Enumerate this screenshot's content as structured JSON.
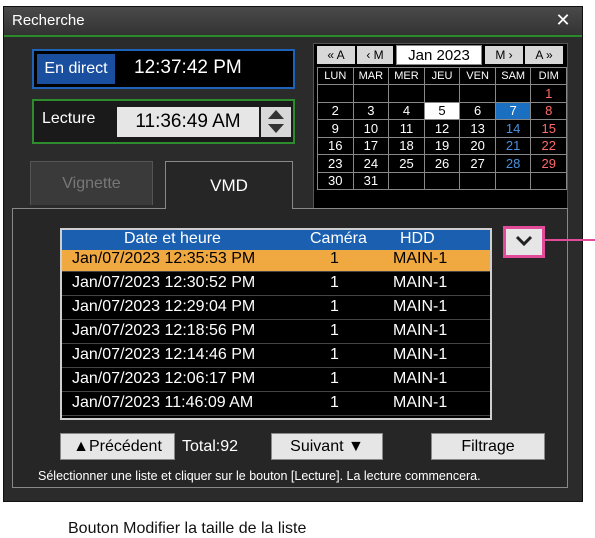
{
  "window": {
    "title": "Recherche",
    "close": "✕"
  },
  "live": {
    "label": "En direct",
    "time": "12:37:42 PM"
  },
  "playback": {
    "label": "Lecture",
    "time": "11:36:49 AM"
  },
  "calendar": {
    "prev_year": "« A",
    "prev_month": "‹ M",
    "month": "Jan 2023",
    "next_month": "M ›",
    "next_year": "A »",
    "days": [
      "LUN",
      "MAR",
      "MER",
      "JEU",
      "VEN",
      "SAM",
      "DIM"
    ],
    "weeks": [
      [
        "",
        "",
        "",
        "",
        "",
        "",
        "1"
      ],
      [
        "2",
        "3",
        "4",
        "5",
        "6",
        "7",
        "8"
      ],
      [
        "9",
        "10",
        "11",
        "12",
        "13",
        "14",
        "15"
      ],
      [
        "16",
        "17",
        "18",
        "19",
        "20",
        "21",
        "22"
      ],
      [
        "23",
        "24",
        "25",
        "26",
        "27",
        "28",
        "29"
      ],
      [
        "30",
        "31",
        "",
        "",
        "",
        "",
        ""
      ]
    ]
  },
  "tabs": {
    "thumbnail": "Vignette",
    "vmd": "VMD"
  },
  "list": {
    "headers": {
      "datetime": "Date et heure",
      "camera": "Caméra",
      "hdd": "HDD"
    },
    "rows": [
      {
        "datetime": "Jan/07/2023   12:35:53 PM",
        "camera": "1",
        "hdd": "MAIN-1"
      },
      {
        "datetime": "Jan/07/2023   12:30:52 PM",
        "camera": "1",
        "hdd": "MAIN-1"
      },
      {
        "datetime": "Jan/07/2023   12:29:04 PM",
        "camera": "1",
        "hdd": "MAIN-1"
      },
      {
        "datetime": "Jan/07/2023   12:18:56 PM",
        "camera": "1",
        "hdd": "MAIN-1"
      },
      {
        "datetime": "Jan/07/2023   12:14:46 PM",
        "camera": "1",
        "hdd": "MAIN-1"
      },
      {
        "datetime": "Jan/07/2023   12:06:17 PM",
        "camera": "1",
        "hdd": "MAIN-1"
      },
      {
        "datetime": "Jan/07/2023   11:46:09 AM",
        "camera": "1",
        "hdd": "MAIN-1"
      }
    ]
  },
  "controls": {
    "prev": "▲Précédent",
    "total": "Total:92",
    "next": "Suivant ▼",
    "filter": "Filtrage"
  },
  "hint": "Sélectionner une liste et cliquer sur le bouton [Lecture]. La lecture commencera.",
  "caption": "Bouton Modifier la taille de la liste",
  "colors": {
    "accent_blue": "#1a5fb0",
    "selected_row": "#f0a840",
    "callout": "#e24a9a"
  }
}
